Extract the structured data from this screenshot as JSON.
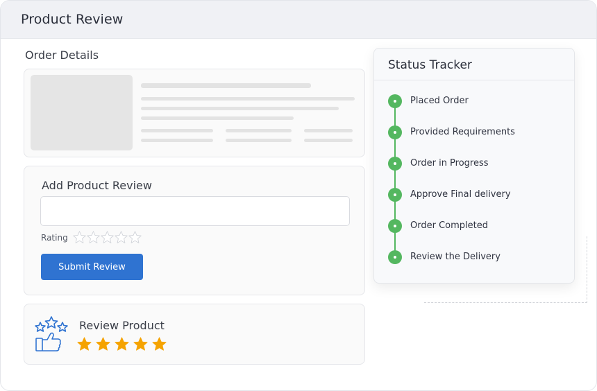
{
  "app": {
    "title": "Product Review"
  },
  "order_details": {
    "label": "Order Details"
  },
  "review_form": {
    "heading": "Add Product Review",
    "input_value": "",
    "input_placeholder": "",
    "rating_label": "Rating",
    "rating_value": 0,
    "rating_max": 5,
    "submit_label": "Submit Review"
  },
  "review_product": {
    "heading": "Review Product",
    "stars": 5,
    "star_color": "#f5a300"
  },
  "status_tracker": {
    "title": "Status Tracker",
    "accent": "#54b760",
    "steps": [
      {
        "label": "Placed Order"
      },
      {
        "label": "Provided Requirements"
      },
      {
        "label": "Order in Progress"
      },
      {
        "label": "Approve Final delivery"
      },
      {
        "label": "Order Completed"
      },
      {
        "label": "Review the Delivery"
      }
    ]
  },
  "colors": {
    "primary": "#2f73d1",
    "success": "#54b760",
    "star": "#f5a300"
  }
}
